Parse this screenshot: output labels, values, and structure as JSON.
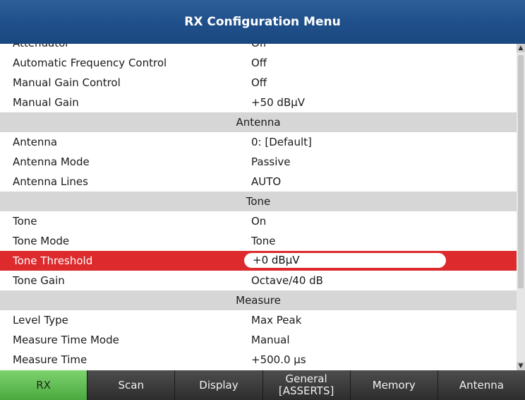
{
  "window": {
    "title": "RX Configuration Menu"
  },
  "list": {
    "rows": [
      {
        "label": "Attenuator",
        "value": "Off"
      },
      {
        "label": "Automatic Frequency Control",
        "value": "Off"
      },
      {
        "label": "Manual Gain Control",
        "value": "Off"
      },
      {
        "label": "Manual Gain",
        "value": "+50 dBµV"
      },
      {
        "section": "Antenna"
      },
      {
        "label": "Antenna",
        "value": "0: [Default]"
      },
      {
        "label": "Antenna Mode",
        "value": "Passive"
      },
      {
        "label": "Antenna Lines",
        "value": "AUTO"
      },
      {
        "section": "Tone"
      },
      {
        "label": "Tone",
        "value": "On"
      },
      {
        "label": "Tone Mode",
        "value": "Tone"
      },
      {
        "label": "Tone Threshold",
        "value": "+0 dBµV",
        "selected": true
      },
      {
        "label": "Tone Gain",
        "value": "Octave/40 dB"
      },
      {
        "section": "Measure"
      },
      {
        "label": "Level Type",
        "value": "Max Peak"
      },
      {
        "label": "Measure Time Mode",
        "value": "Manual"
      },
      {
        "label": "Measure Time",
        "value": "+500.0 µs"
      }
    ]
  },
  "scrollbar": {
    "up_icon": "triangle-up-icon",
    "down_icon": "triangle-down-icon"
  },
  "softkeys": [
    {
      "line1": "RX",
      "line2": "",
      "active": true
    },
    {
      "line1": "Scan",
      "line2": ""
    },
    {
      "line1": "Display",
      "line2": ""
    },
    {
      "line1": "General",
      "line2": "[ASSERTS]"
    },
    {
      "line1": "Memory",
      "line2": ""
    },
    {
      "line1": "Antenna",
      "line2": ""
    }
  ],
  "colors": {
    "title_bar": "#1f4f8a",
    "section_bg": "#d6d6d6",
    "selected_row": "#dd2a2d",
    "active_softkey": "#5cb84a",
    "softkey_bg": "#3a3a3a"
  }
}
